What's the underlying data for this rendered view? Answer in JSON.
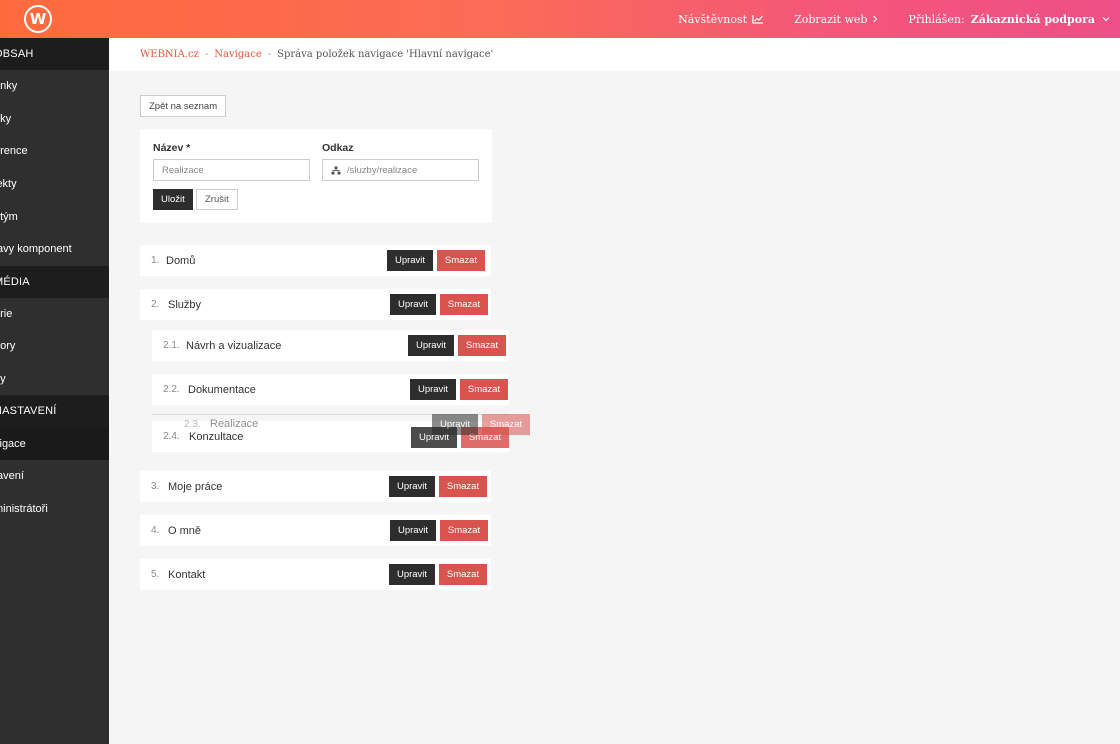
{
  "header": {
    "logo_letter": "W",
    "visits_label": "Návštěvnost",
    "view_web_label": "Zobrazit web",
    "logged_in_label": "Přihlášen:",
    "user_name": "Zákaznická podpora"
  },
  "sidebar": {
    "sections": [
      {
        "title": "OBSAH",
        "items": [
          "ánky",
          "nky",
          "erence",
          "jekty",
          "í tým",
          "tavy komponent"
        ]
      },
      {
        "title": "MÉDIA",
        "items": [
          "erie",
          "bory",
          "ny"
        ]
      },
      {
        "title": "NASTAVENÍ",
        "items": [
          "vigace",
          "tavení",
          "ministrátoři"
        ]
      }
    ],
    "active_item": "vigace"
  },
  "breadcrumb": {
    "items": [
      "WEBNIA.cz",
      "Navigace"
    ],
    "current": "Správa položek navigace 'Hlavní navigace'",
    "separator": "-"
  },
  "back_button": "Zpět na seznam",
  "form": {
    "name_label": "Název *",
    "name_value": "Realizace",
    "link_label": "Odkaz",
    "link_value": "/sluzby/realizace",
    "save_label": "Uložit",
    "cancel_label": "Zrušit"
  },
  "actions": {
    "edit": "Upravit",
    "delete": "Smazat"
  },
  "nav_items": [
    {
      "num": "1.",
      "label": "Domů"
    },
    {
      "num": "2.",
      "label": "Služby"
    },
    {
      "num": "2.1.",
      "label": "Návrh a vizualizace"
    },
    {
      "num": "2.2.",
      "label": "Dokumentace"
    },
    {
      "num": "2.4.",
      "label": "Konzultace"
    },
    {
      "num": "3.",
      "label": "Moje práce"
    },
    {
      "num": "4.",
      "label": "O mně"
    },
    {
      "num": "5.",
      "label": "Kontakt"
    }
  ],
  "dragging_item": {
    "num": "2.3.",
    "label": "Realizace"
  },
  "colors": {
    "header_start": "#ff6a3d",
    "header_end": "#ee4f86",
    "accent": "#e8543e",
    "delete": "#d9534f",
    "dark": "#2d2d2d"
  }
}
